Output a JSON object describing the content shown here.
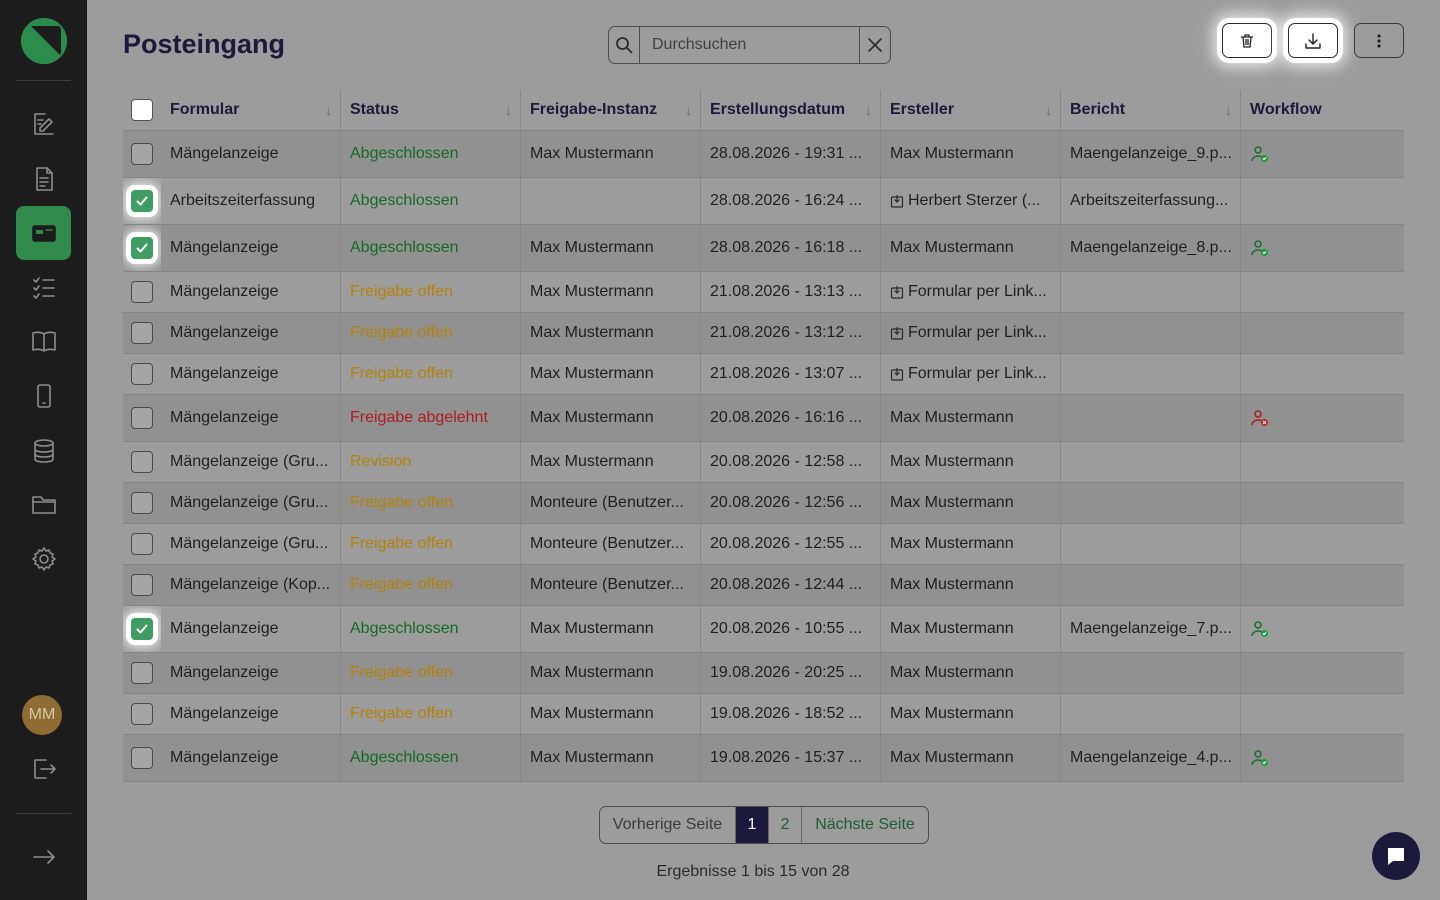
{
  "page": {
    "title": "Posteingang"
  },
  "search": {
    "placeholder": "Durchsuchen"
  },
  "sidebar": {
    "items": [
      {
        "icon": "form-edit-icon"
      },
      {
        "icon": "document-icon"
      },
      {
        "icon": "inbox-icon",
        "active": true
      },
      {
        "icon": "checklist-icon"
      },
      {
        "icon": "book-icon"
      },
      {
        "icon": "mobile-icon"
      },
      {
        "icon": "database-icon"
      },
      {
        "icon": "folder-icon"
      },
      {
        "icon": "settings-icon"
      }
    ],
    "avatar_initials": "MM"
  },
  "table": {
    "columns": [
      "Formular",
      "Status",
      "Freigabe-Instanz",
      "Erstellungsdatum",
      "Ersteller",
      "Bericht",
      "Workflow"
    ],
    "rows": [
      {
        "checked": false,
        "formular": "Mängelanzeige",
        "status": "Abgeschlossen",
        "status_type": "done",
        "instanz": "Max Mustermann",
        "datum": "28.08.2026 - 19:31 ...",
        "ersteller": "Max Mustermann",
        "ersteller_link": false,
        "bericht": "Maengelanzeige_9.p...",
        "workflow": "ok"
      },
      {
        "checked": true,
        "formular": "Arbeitszeiterfassung",
        "status": "Abgeschlossen",
        "status_type": "done",
        "instanz": "",
        "datum": "28.08.2026 - 16:24 ...",
        "ersteller": "Herbert Sterzer (...",
        "ersteller_link": true,
        "bericht": "Arbeitszeiterfassung...",
        "workflow": ""
      },
      {
        "checked": true,
        "formular": "Mängelanzeige",
        "status": "Abgeschlossen",
        "status_type": "done",
        "instanz": "Max Mustermann",
        "datum": "28.08.2026 - 16:18 ...",
        "ersteller": "Max Mustermann",
        "ersteller_link": false,
        "bericht": "Maengelanzeige_8.p...",
        "workflow": "ok"
      },
      {
        "checked": false,
        "formular": "Mängelanzeige",
        "status": "Freigabe offen",
        "status_type": "open",
        "instanz": "Max Mustermann",
        "datum": "21.08.2026 - 13:13 ...",
        "ersteller": "Formular per Link...",
        "ersteller_link": true,
        "bericht": "",
        "workflow": ""
      },
      {
        "checked": false,
        "formular": "Mängelanzeige",
        "status": "Freigabe offen",
        "status_type": "open",
        "instanz": "Max Mustermann",
        "datum": "21.08.2026 - 13:12 ...",
        "ersteller": "Formular per Link...",
        "ersteller_link": true,
        "bericht": "",
        "workflow": ""
      },
      {
        "checked": false,
        "formular": "Mängelanzeige",
        "status": "Freigabe offen",
        "status_type": "open",
        "instanz": "Max Mustermann",
        "datum": "21.08.2026 - 13:07 ...",
        "ersteller": "Formular per Link...",
        "ersteller_link": true,
        "bericht": "",
        "workflow": ""
      },
      {
        "checked": false,
        "formular": "Mängelanzeige",
        "status": "Freigabe abgelehnt",
        "status_type": "rejected",
        "instanz": "Max Mustermann",
        "datum": "20.08.2026 - 16:16 ...",
        "ersteller": "Max Mustermann",
        "ersteller_link": false,
        "bericht": "",
        "workflow": "rejected"
      },
      {
        "checked": false,
        "formular": "Mängelanzeige (Gru...",
        "status": "Revision",
        "status_type": "open",
        "instanz": "Max Mustermann",
        "datum": "20.08.2026 - 12:58 ...",
        "ersteller": "Max Mustermann",
        "ersteller_link": false,
        "bericht": "",
        "workflow": ""
      },
      {
        "checked": false,
        "formular": "Mängelanzeige (Gru...",
        "status": "Freigabe offen",
        "status_type": "open",
        "instanz": "Monteure (Benutzer...",
        "datum": "20.08.2026 - 12:56 ...",
        "ersteller": "Max Mustermann",
        "ersteller_link": false,
        "bericht": "",
        "workflow": ""
      },
      {
        "checked": false,
        "formular": "Mängelanzeige (Gru...",
        "status": "Freigabe offen",
        "status_type": "open",
        "instanz": "Monteure (Benutzer...",
        "datum": "20.08.2026 - 12:55 ...",
        "ersteller": "Max Mustermann",
        "ersteller_link": false,
        "bericht": "",
        "workflow": ""
      },
      {
        "checked": false,
        "formular": "Mängelanzeige (Kop...",
        "status": "Freigabe offen",
        "status_type": "open",
        "instanz": "Monteure (Benutzer...",
        "datum": "20.08.2026 - 12:44 ...",
        "ersteller": "Max Mustermann",
        "ersteller_link": false,
        "bericht": "",
        "workflow": ""
      },
      {
        "checked": true,
        "formular": "Mängelanzeige",
        "status": "Abgeschlossen",
        "status_type": "done",
        "instanz": "Max Mustermann",
        "datum": "20.08.2026 - 10:55 ...",
        "ersteller": "Max Mustermann",
        "ersteller_link": false,
        "bericht": "Maengelanzeige_7.p...",
        "workflow": "ok"
      },
      {
        "checked": false,
        "formular": "Mängelanzeige",
        "status": "Freigabe offen",
        "status_type": "open",
        "instanz": "Max Mustermann",
        "datum": "19.08.2026 - 20:25 ...",
        "ersteller": "Max Mustermann",
        "ersteller_link": false,
        "bericht": "",
        "workflow": ""
      },
      {
        "checked": false,
        "formular": "Mängelanzeige",
        "status": "Freigabe offen",
        "status_type": "open",
        "instanz": "Max Mustermann",
        "datum": "19.08.2026 - 18:52 ...",
        "ersteller": "Max Mustermann",
        "ersteller_link": false,
        "bericht": "",
        "workflow": ""
      },
      {
        "checked": false,
        "formular": "Mängelanzeige",
        "status": "Abgeschlossen",
        "status_type": "done",
        "instanz": "Max Mustermann",
        "datum": "19.08.2026 - 15:37 ...",
        "ersteller": "Max Mustermann",
        "ersteller_link": false,
        "bericht": "Maengelanzeige_4.p...",
        "workflow": "ok"
      }
    ]
  },
  "pagination": {
    "prev_label": "Vorherige Seite",
    "pages": [
      "1",
      "2"
    ],
    "current_page": "1",
    "next_label": "Nächste Seite",
    "results_text": "Ergebnisse 1 bis 15 von 28"
  },
  "colors": {
    "done": "#136b24",
    "open": "#b48207",
    "rejected": "#b01c1c",
    "accent": "#2f8a4c",
    "title": "#1c1a3c"
  }
}
